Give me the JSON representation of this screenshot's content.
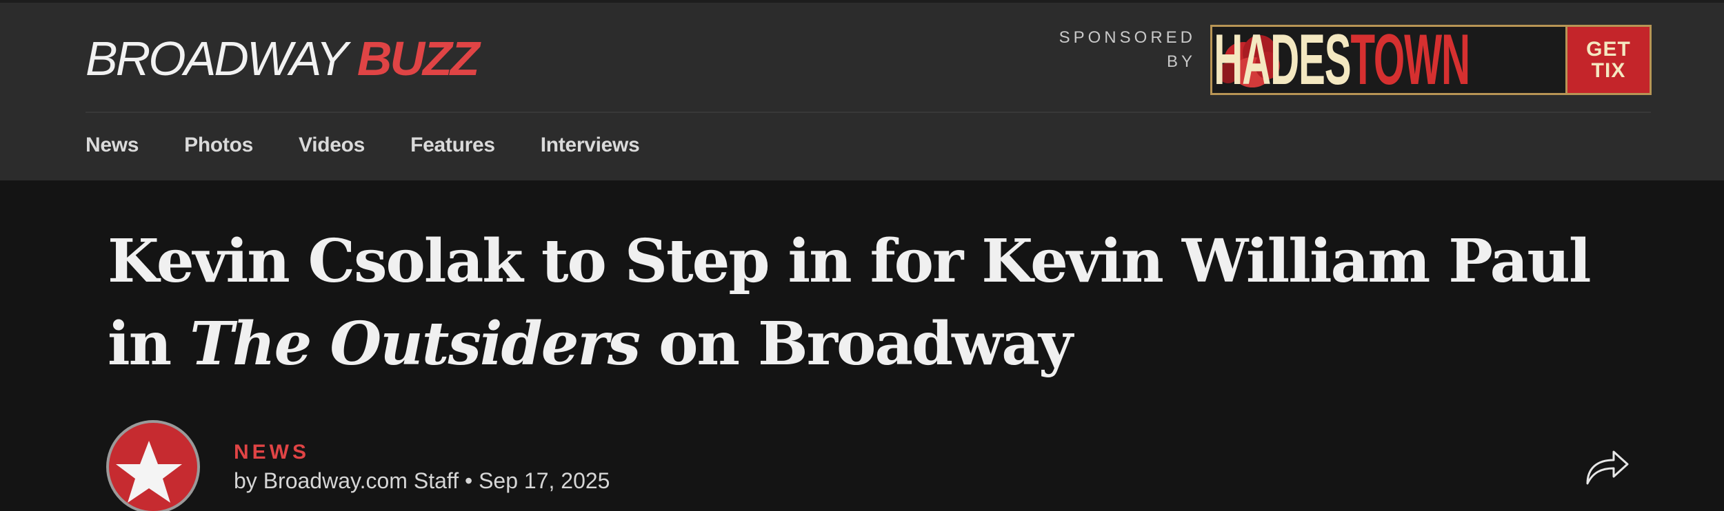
{
  "site": {
    "logo_part1": "BROADWAY",
    "logo_part2": "BUZZ",
    "sponsor_label_line1": "SPONSORED",
    "sponsor_label_line2": "BY",
    "ad": {
      "title_part1": "HADES",
      "title_part2": "TOWN",
      "cta_line1": "GET",
      "cta_line2": "TIX"
    }
  },
  "nav": {
    "items": [
      "News",
      "Photos",
      "Videos",
      "Features",
      "Interviews"
    ]
  },
  "article": {
    "headline_part1": "Kevin Csolak to Step in for Kevin William Paul in",
    "headline_italic": "The Outsiders",
    "headline_part2": "on Broadway",
    "category": "NEWS",
    "byline": "by Broadway.com Staff • Sep 17, 2025"
  },
  "icons": {
    "avatar": "star-icon",
    "share": "share-arrow-icon"
  },
  "colors": {
    "accent": "#e04445",
    "header_bg": "#2c2c2c",
    "page_bg": "#141414"
  }
}
